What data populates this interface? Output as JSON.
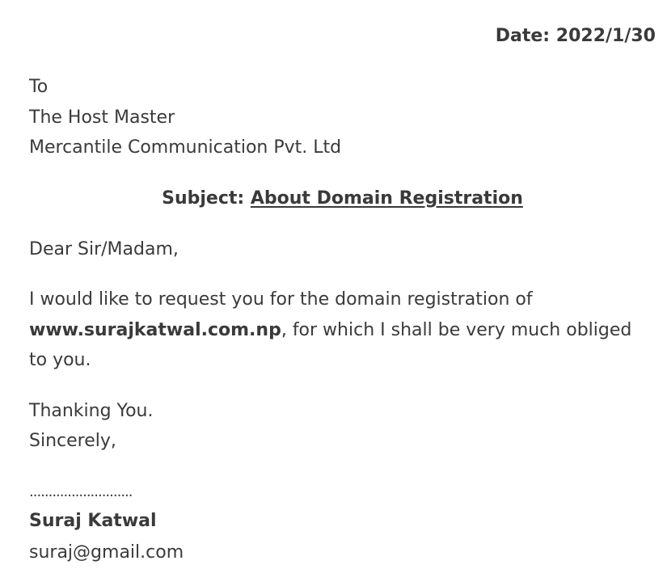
{
  "date": {
    "label": "Date:",
    "value": "2022/1/30"
  },
  "recipient": {
    "to": "To",
    "name": "The Host Master",
    "company": "Mercantile Communication Pvt. Ltd"
  },
  "subject": {
    "label": "Subject:",
    "text": "About Domain Registration"
  },
  "salutation": "Dear Sir/Madam,",
  "body": {
    "intro": "I would like to request you for the domain registration of",
    "domain": "www.surajkatwal.com.np",
    "rest": ", for which I shall be very much obliged to you."
  },
  "closing": {
    "thanks": "Thanking You.",
    "sign_off": "Sincerely,"
  },
  "signature": {
    "dots": "...........................",
    "name": "Suraj Katwal",
    "email": "suraj@gmail.com"
  }
}
